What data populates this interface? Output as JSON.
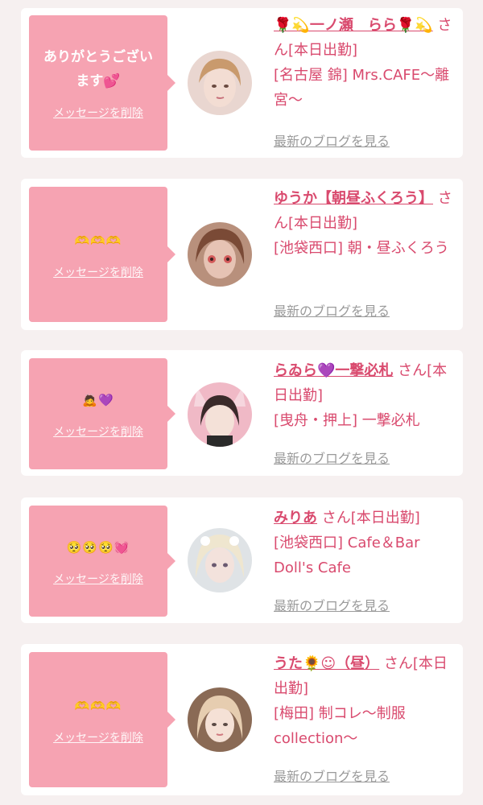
{
  "ui": {
    "delete_label": "メッセージを削除",
    "blog_label": "最新のブログを見る"
  },
  "items": [
    {
      "message": "ありがとうございます💕",
      "name": "🌹💫一ノ瀬　らら🌹💫",
      "suffix": " さん[本日出勤]",
      "shop": "[名古屋 錦] Mrs.CAFE〜離宮〜"
    },
    {
      "message": "🫶🫶🫶",
      "name": "ゆうか【朝昼ふくろう】",
      "suffix": " さん[本日出勤]",
      "shop": "[池袋西口] 朝・昼ふくろう"
    },
    {
      "message": "🙇💜",
      "name": "らゐら💜一撃必札",
      "suffix": " さん[本日出勤]",
      "shop": "[曳舟・押上] 一撃必札"
    },
    {
      "message": "🥺🥺🥺💓",
      "name": "みりあ",
      "suffix": " さん[本日出勤]",
      "shop": "[池袋西口] Cafe＆Bar Doll's Cafe"
    },
    {
      "message": "🫶🫶🫶",
      "name": "うた🌻☺︎（昼）",
      "suffix": " さん[本日出勤]",
      "shop": "[梅田] 制コレ〜制服collection〜"
    }
  ]
}
